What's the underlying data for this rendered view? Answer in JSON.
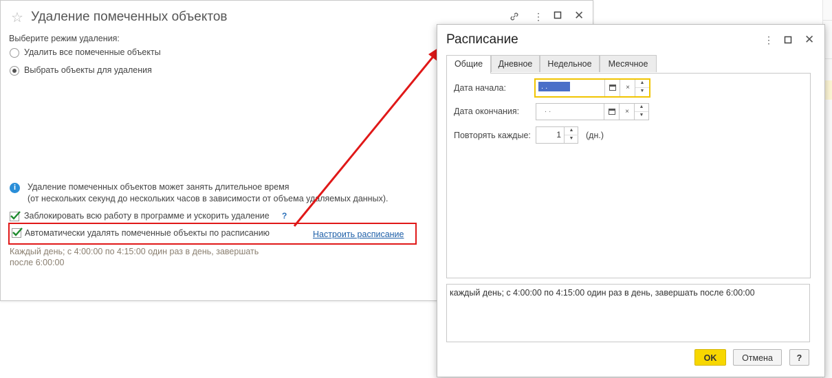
{
  "main_window": {
    "title": "Удаление помеченных объектов",
    "mode_label": "Выберите режим удаления:",
    "radio_options": [
      {
        "label": "Удалить все помеченные объекты",
        "selected": false
      },
      {
        "label": "Выбрать объекты для удаления",
        "selected": true
      }
    ],
    "info_line1": "Удаление помеченных объектов может занять длительное время",
    "info_line2": "(от нескольких секунд до нескольких часов в зависимости от объема удаляемых данных).",
    "lock_checkbox_label": "Заблокировать всю работу в программе и ускорить удаление",
    "lock_help": "?",
    "auto_checkbox_label": "Автоматически удалять помеченные объекты по расписанию",
    "schedule_link": "Настроить расписание",
    "schedule_summary_line1": "Каждый день; с 4:00:00 по 4:15:00 один раз в день, завершать",
    "schedule_summary_line2": "после 6:00:00"
  },
  "dialog": {
    "title": "Расписание",
    "tabs": [
      {
        "label": "Общие",
        "active": true
      },
      {
        "label": "Дневное",
        "active": false
      },
      {
        "label": "Недельное",
        "active": false
      },
      {
        "label": "Месячное",
        "active": false
      }
    ],
    "start_date_label": "Дата начала:",
    "start_date_value": " .  .",
    "end_date_label": "Дата окончания:",
    "end_date_value": " .  .",
    "repeat_label": "Повторять каждые:",
    "repeat_value": "1",
    "repeat_unit": "(дн.)",
    "description": "каждый день; с 4:00:00 по 4:15:00 один раз в день, завершать после 6:00:00",
    "ok_label": "OK",
    "cancel_label": "Отмена",
    "help_label": "?"
  },
  "colors": {
    "accent_yellow": "#f7d700",
    "highlight_red": "#e01818",
    "link_blue": "#1e5fa8",
    "selection_blue": "#4a6fc8"
  }
}
